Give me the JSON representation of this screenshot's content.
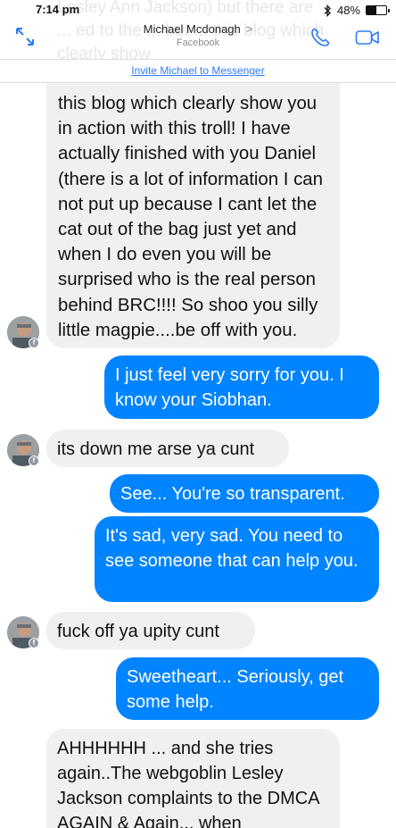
{
  "status": {
    "time": "7:14 pm",
    "battery": "48%",
    "battery_level": 0.48
  },
  "header": {
    "name": "Michael Mcdonagh",
    "chevron": ">",
    "subtitle": "Facebook",
    "invite": "Invite Michael to Messenger"
  },
  "ghost_text": "Lesley Ann Jackson) but there are ... ed to the ... but ... this blog which clearly show",
  "messages": [
    {
      "from": "them",
      "text": "this blog which clearly show you in action with this troll! I have actually finished with you Daniel (there is a lot of information I can not put up because I cant let the cat out of the bag just yet and when I do even you will be surprised who is the real person behind BRC!!!! So shoo you silly little magpie....be off with you."
    },
    {
      "from": "me",
      "text": "I just feel very sorry for you. I know your Siobhan."
    },
    {
      "from": "them",
      "text": "its down me arse ya cunt"
    },
    {
      "from": "me",
      "text": "See... You're so transparent."
    },
    {
      "from": "me",
      "text": "It's sad, very sad. You need to see someone that can help you."
    },
    {
      "from": "them",
      "text": "fuck off ya upity cunt"
    },
    {
      "from": "me",
      "text": "Sweetheart... Seriously, get some help."
    },
    {
      "from": "them",
      "text": "AHHHHHH ... and she tries again..The webgoblin Lesley Jackson complaints to the DMCA AGAIN & Again... when"
    }
  ],
  "colors": {
    "outgoing": "#0084ff",
    "incoming": "#f1f0f0",
    "link": "#2d7bf4"
  }
}
